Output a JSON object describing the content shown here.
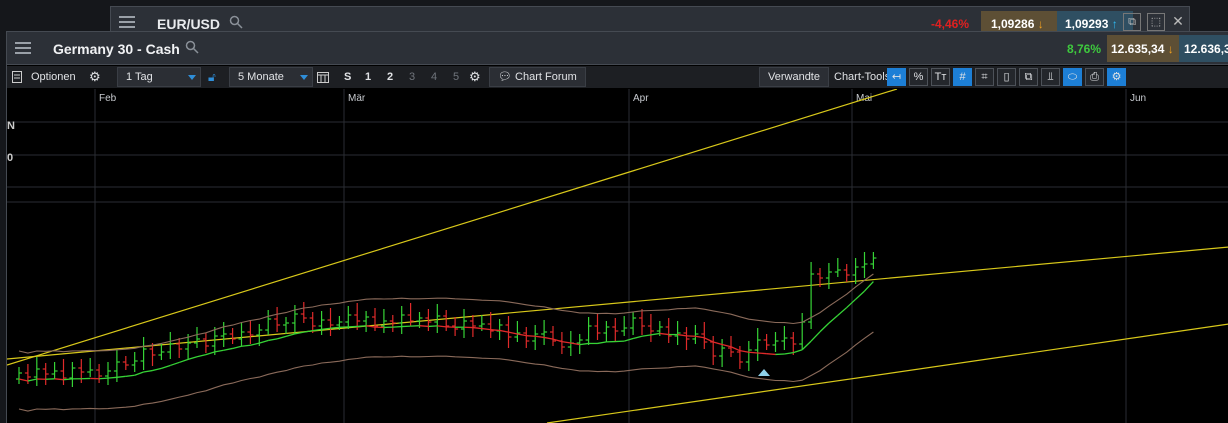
{
  "back_window": {
    "title": "EUR/USD",
    "change": "-4,46%",
    "sell": "1,09286",
    "buy": "1,09293",
    "close_glyph": "✕"
  },
  "front_window": {
    "title": "Germany 30 - Cash",
    "change": "8,76%",
    "sell": "12.635,34",
    "buy": "12.636,3"
  },
  "toolbar": {
    "options_label": "Optionen",
    "interval_value": "1 Tag",
    "range_value": "5 Monate",
    "zoom_levels": [
      "S",
      "1",
      "2",
      "3",
      "4",
      "5"
    ],
    "chart_forum_label": "Chart Forum",
    "related_label": "Verwandte",
    "chart_tools_label": "Chart-Tools",
    "tools": [
      {
        "name": "cursor-tool-icon",
        "glyph": "↤",
        "active": true
      },
      {
        "name": "percent-tool-icon",
        "glyph": "%",
        "active": false
      },
      {
        "name": "text-tool-icon",
        "glyph": "Tт",
        "active": false
      },
      {
        "name": "grid-tool-icon",
        "glyph": "#",
        "active": true
      },
      {
        "name": "crosshair-tool-icon",
        "glyph": "⌗",
        "active": false
      },
      {
        "name": "candle-tool-icon",
        "glyph": "▯",
        "active": false
      },
      {
        "name": "compare-tool-icon",
        "glyph": "⧉",
        "active": false
      },
      {
        "name": "indicator-tool-icon",
        "glyph": "⫫",
        "active": false
      },
      {
        "name": "label-tool-icon",
        "glyph": "⬭",
        "active": true
      },
      {
        "name": "print-tool-icon",
        "glyph": "⎙",
        "active": false
      },
      {
        "name": "settings-tool-icon",
        "glyph": "⚙",
        "active": true
      }
    ]
  },
  "chart": {
    "month_labels": [
      "Feb",
      "Mär",
      "Apr",
      "Mai",
      "Jun"
    ],
    "edge_labels": [
      "N",
      "0"
    ],
    "colors": {
      "up": "#36d336",
      "down": "#e02a2a",
      "trendline": "#d8c81a",
      "band": "#8a6a5a",
      "grid": "#2a2d33"
    }
  }
}
